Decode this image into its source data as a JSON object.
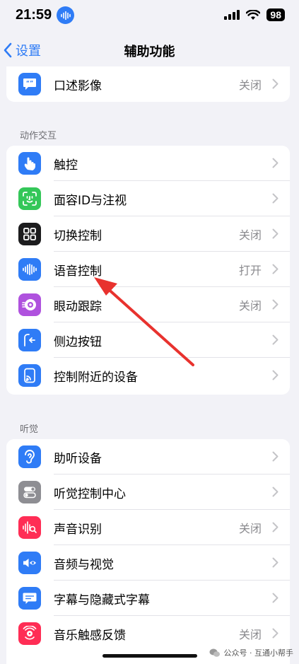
{
  "status": {
    "time": "21:59",
    "battery": "98"
  },
  "nav": {
    "back_label": "设置",
    "title": "辅助功能"
  },
  "top_item": {
    "label": "口述影像",
    "value": "关闭"
  },
  "sections": {
    "interaction_header": "动作交互",
    "hearing_header": "听觉"
  },
  "interaction_items": [
    {
      "label": "触控",
      "value": "",
      "icon": "touch-hand-icon",
      "color": "#2f7cf6"
    },
    {
      "label": "面容ID与注视",
      "value": "",
      "icon": "face-id-icon",
      "color": "#34c759"
    },
    {
      "label": "切换控制",
      "value": "关闭",
      "icon": "switch-control-icon",
      "color": "#1c1c1e"
    },
    {
      "label": "语音控制",
      "value": "打开",
      "icon": "voice-control-icon",
      "color": "#2f7cf6"
    },
    {
      "label": "眼动跟踪",
      "value": "关闭",
      "icon": "eye-tracking-icon",
      "color": "#af52de"
    },
    {
      "label": "侧边按钮",
      "value": "",
      "icon": "side-button-icon",
      "color": "#2f7cf6"
    },
    {
      "label": "控制附近的设备",
      "value": "",
      "icon": "nearby-devices-icon",
      "color": "#2f7cf6"
    }
  ],
  "hearing_items": [
    {
      "label": "助听设备",
      "value": "",
      "icon": "ear-icon",
      "color": "#2f7cf6"
    },
    {
      "label": "听觉控制中心",
      "value": "",
      "icon": "toggles-icon",
      "color": "#8e8e93"
    },
    {
      "label": "声音识别",
      "value": "关闭",
      "icon": "sound-recognition-icon",
      "color": "#ff2d55"
    },
    {
      "label": "音频与视觉",
      "value": "",
      "icon": "speaker-eye-icon",
      "color": "#2f7cf6"
    },
    {
      "label": "字幕与隐藏式字幕",
      "value": "",
      "icon": "subtitles-icon",
      "color": "#2f7cf6"
    },
    {
      "label": "音乐触感反馈",
      "value": "关闭",
      "icon": "music-haptics-icon",
      "color": "#ff2d55"
    }
  ],
  "watermark": "公众号 · 互通小帮手"
}
